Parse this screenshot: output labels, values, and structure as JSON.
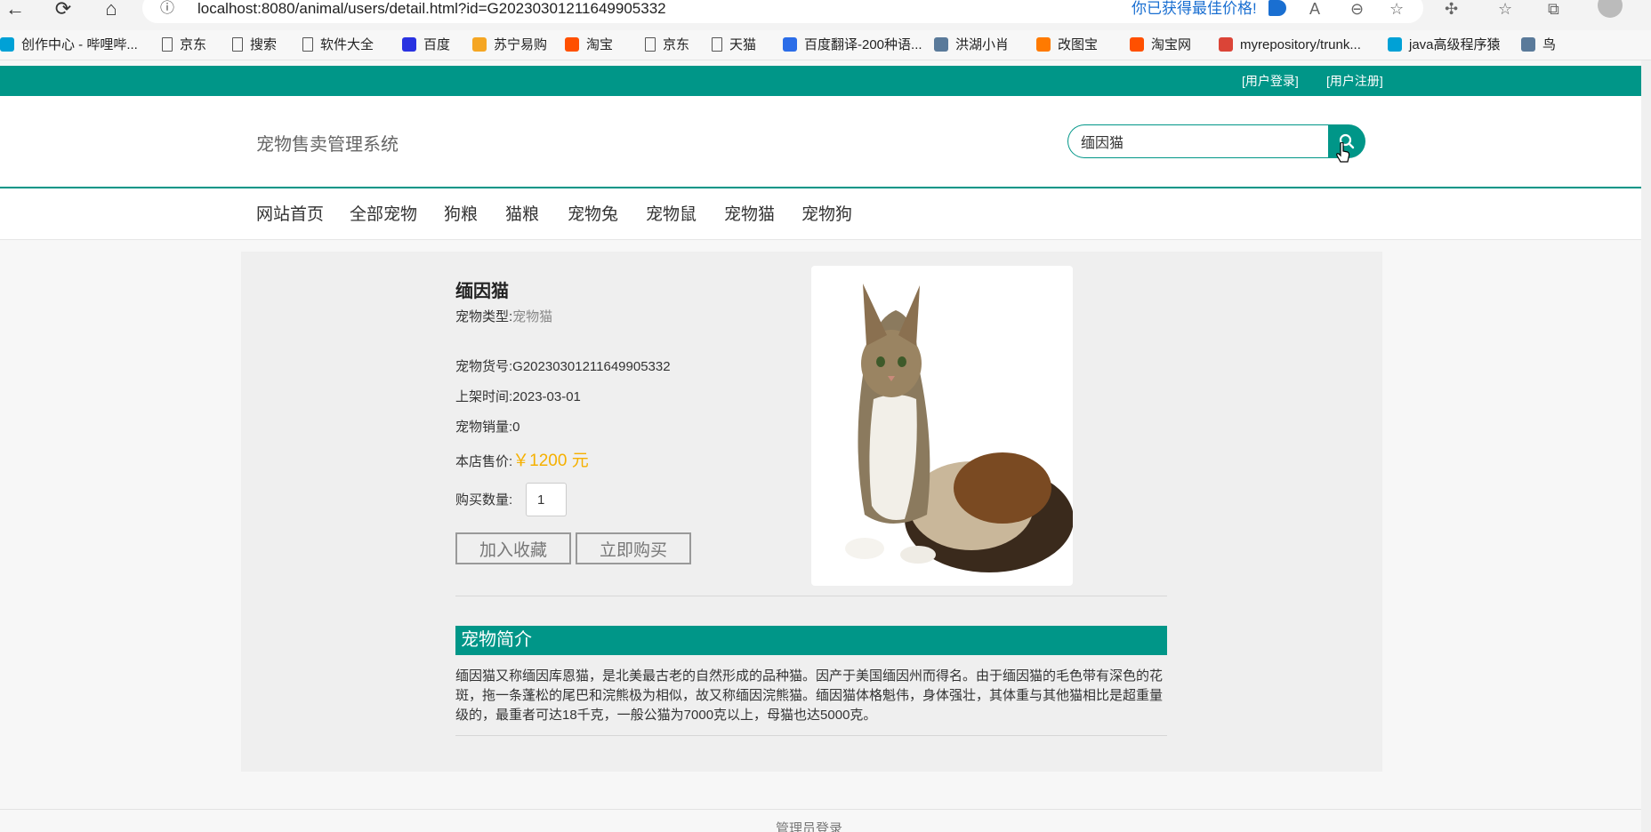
{
  "browser": {
    "url": "localhost:8080/animal/users/detail.html?id=G20230301211649905332",
    "price_note": "你已获得最佳价格!",
    "bookmarks": [
      {
        "label": "创作中心 - 哔哩哔...",
        "icon": "bilibili-icon"
      },
      {
        "label": "京东",
        "icon": "page-icon"
      },
      {
        "label": "搜索",
        "icon": "page-icon"
      },
      {
        "label": "软件大全",
        "icon": "page-icon"
      },
      {
        "label": "百度",
        "icon": "baidu-icon"
      },
      {
        "label": "苏宁易购",
        "icon": "suning-icon"
      },
      {
        "label": "淘宝",
        "icon": "taobao-icon"
      },
      {
        "label": "京东",
        "icon": "page-icon"
      },
      {
        "label": "天猫",
        "icon": "page-icon"
      },
      {
        "label": "百度翻译-200种语...",
        "icon": "translate-icon"
      },
      {
        "label": "洪湖小肖",
        "icon": "bird-icon"
      },
      {
        "label": "改图宝",
        "icon": "gaitubao-icon"
      },
      {
        "label": "淘宝网",
        "icon": "taobao-icon"
      },
      {
        "label": "myrepository/trunk...",
        "icon": "chrome-icon"
      },
      {
        "label": "java高级程序猿",
        "icon": "bilibili-icon"
      },
      {
        "label": "鸟",
        "icon": "bird-icon"
      }
    ]
  },
  "topbar": {
    "login": "[用户登录]",
    "register": "[用户注册]"
  },
  "header": {
    "title": "宠物售卖管理系统",
    "search_value": "缅因猫"
  },
  "menu": [
    "网站首页",
    "全部宠物",
    "狗粮",
    "猫粮",
    "宠物兔",
    "宠物鼠",
    "宠物猫",
    "宠物狗"
  ],
  "pet": {
    "name": "缅因猫",
    "type_label": "宠物类型:",
    "type_value": "宠物猫",
    "sku_label": "宠物货号:",
    "sku_value": "G20230301211649905332",
    "date_label": "上架时间:",
    "date_value": "2023-03-01",
    "sales_label": "宠物销量:",
    "sales_value": "0",
    "price_label": "本店售价:",
    "price_value": "￥1200 元",
    "qty_label": "购买数量:",
    "qty_value": "1",
    "fav_button": "加入收藏",
    "buy_button": "立即购买"
  },
  "intro": {
    "heading": "宠物简介",
    "text": "缅因猫又称缅因库恩猫，是北美最古老的自然形成的品种猫。因产于美国缅因州而得名。由于缅因猫的毛色带有深色的花斑，拖一条蓬松的尾巴和浣熊极为相似，故又称缅因浣熊猫。缅因猫体格魁伟，身体强壮，其体重与其他猫相比是超重量级的，最重者可达18千克，一般公猫为7000克以上，母猫也达5000克。"
  },
  "footer": {
    "admin_login": "管理员登录"
  },
  "colors": {
    "accent": "#009688",
    "price": "#f5b000"
  }
}
